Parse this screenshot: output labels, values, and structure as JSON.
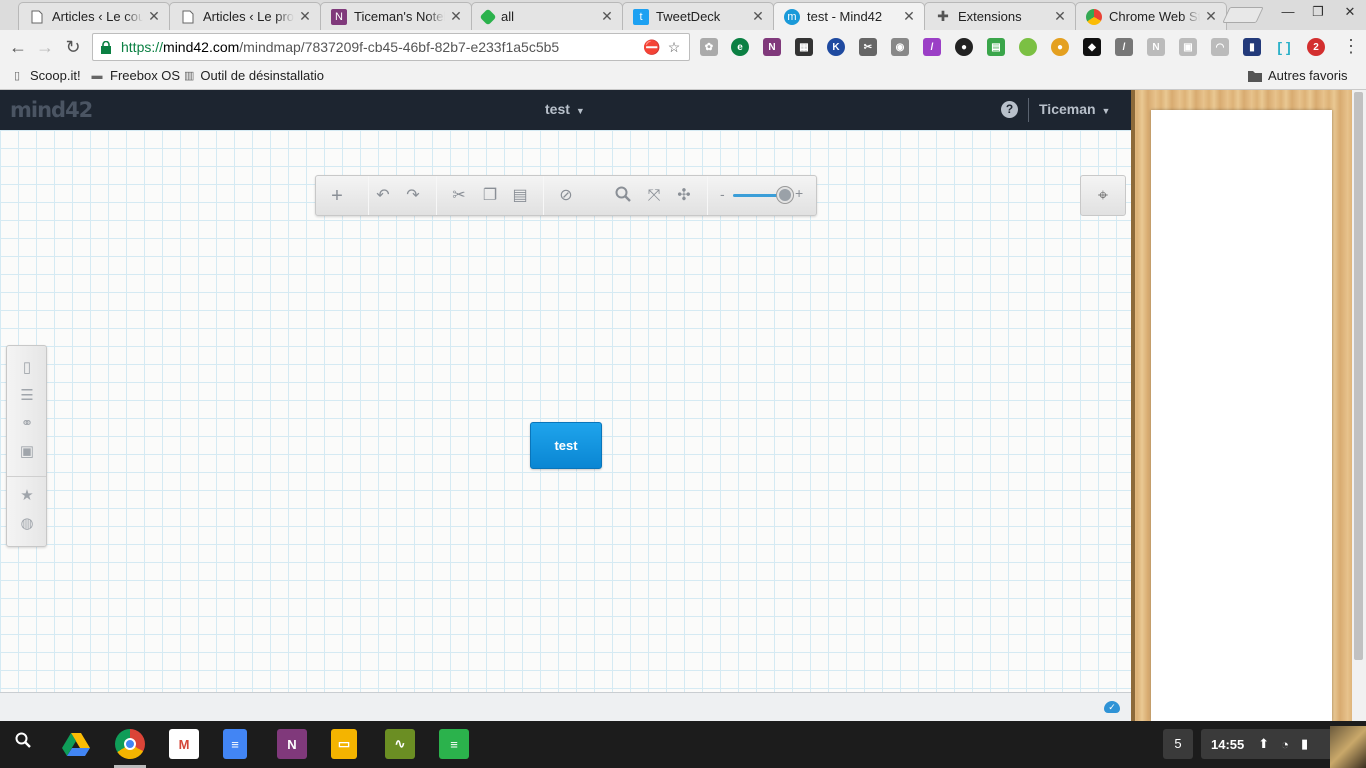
{
  "browser": {
    "tabs": [
      {
        "title": "Articles ‹ Le couti",
        "icon": "page-icon",
        "color": "#ffffff"
      },
      {
        "title": "Articles ‹ Le prop",
        "icon": "page-icon",
        "color": "#ffffff"
      },
      {
        "title": "Ticeman's Notebo",
        "icon": "onenote-icon",
        "color": "#80397b"
      },
      {
        "title": "all",
        "icon": "feedly-icon",
        "color": "#2bb24c"
      },
      {
        "title": "TweetDeck",
        "icon": "twitter-icon",
        "color": "#1da1f2"
      },
      {
        "title": "test - Mind42",
        "icon": "mind42-icon",
        "color": "#1a9ad9"
      },
      {
        "title": "Extensions",
        "icon": "puzzle-icon",
        "color": "#555555"
      },
      {
        "title": "Chrome Web Sto",
        "icon": "webstore-icon",
        "color": "#e94235"
      }
    ],
    "url": {
      "scheme": "https://",
      "host": "mind42.com",
      "path": "/mindmap/7837209f-cb45-46bf-82b7-e233f1a5c5b5"
    },
    "bookmarks": [
      {
        "label": "Scoop.it!",
        "icon": "page-icon"
      },
      {
        "label": "Freebox OS",
        "icon": "freebox-icon"
      },
      {
        "label": "Outil de désinstallatio",
        "icon": "uninstall-icon"
      }
    ],
    "other_bookmarks": "Autres favoris",
    "extension_badge": "2"
  },
  "app": {
    "logo": "mind42",
    "map_title": "test",
    "user": "Ticeman",
    "help_label": "?",
    "root_node": "test"
  },
  "shelf": {
    "workspace_count": "5",
    "clock": "14:55"
  }
}
